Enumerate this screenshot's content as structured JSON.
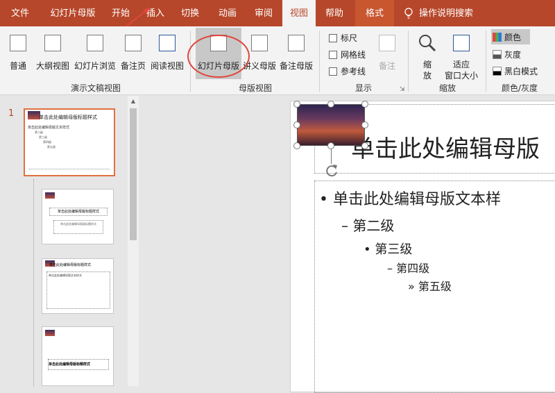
{
  "tabs": [
    "文件",
    "幻灯片母版",
    "开始",
    "插入",
    "切换",
    "动画",
    "审阅",
    "视图",
    "帮助",
    "格式"
  ],
  "search": {
    "label": "操作说明搜索"
  },
  "ribbon": {
    "groups": {
      "presentation_views": {
        "label": "演示文稿视图",
        "buttons": [
          "普通",
          "大纲视图",
          "幻灯片浏览",
          "备注页",
          "阅读视图"
        ]
      },
      "master_views": {
        "label": "母版视图",
        "buttons": [
          "幻灯片母版",
          "讲义母版",
          "备注母版"
        ]
      },
      "show": {
        "label": "显示",
        "checkboxes": [
          "标尺",
          "网格线",
          "参考线"
        ],
        "notes": "备注"
      },
      "zoom": {
        "label": "缩放",
        "zoom_lines": [
          "缩",
          "放"
        ],
        "fit_lines": [
          "适应",
          "窗口大小"
        ]
      },
      "color": {
        "label": "颜色/灰度",
        "options": [
          "颜色",
          "灰度",
          "黑白模式"
        ]
      }
    }
  },
  "thumbnails": {
    "first_number": "1",
    "master_title": "单击此处编辑母版标题样式",
    "master_text": "单击此处编辑母版文本样式",
    "levels_short": [
      "第二级",
      "第三级",
      "第四级",
      "第五级"
    ],
    "layout2_title": "单击此处编辑母版标题样式",
    "layout2_sub": "单击此处编辑母版副标题样式",
    "layout3_title": "单击此处编辑母版标题样式",
    "layout3_text": "单击此处编辑母版文本样式",
    "layout4_title": "单击此处编辑母版标题样式"
  },
  "slide": {
    "title": "单击此处编辑母版",
    "body_text": "单击此处编辑母版文本样",
    "levels": [
      {
        "bullet": "–",
        "text": "第二级"
      },
      {
        "bullet": "•",
        "text": "第三级"
      },
      {
        "bullet": "–",
        "text": "第四级"
      },
      {
        "bullet": "»",
        "text": "第五级"
      }
    ]
  },
  "colors": {
    "tab_bar": "#b7472a",
    "ribbon_bg": "#f3f3f3",
    "highlight_circle": "#e0463c"
  }
}
